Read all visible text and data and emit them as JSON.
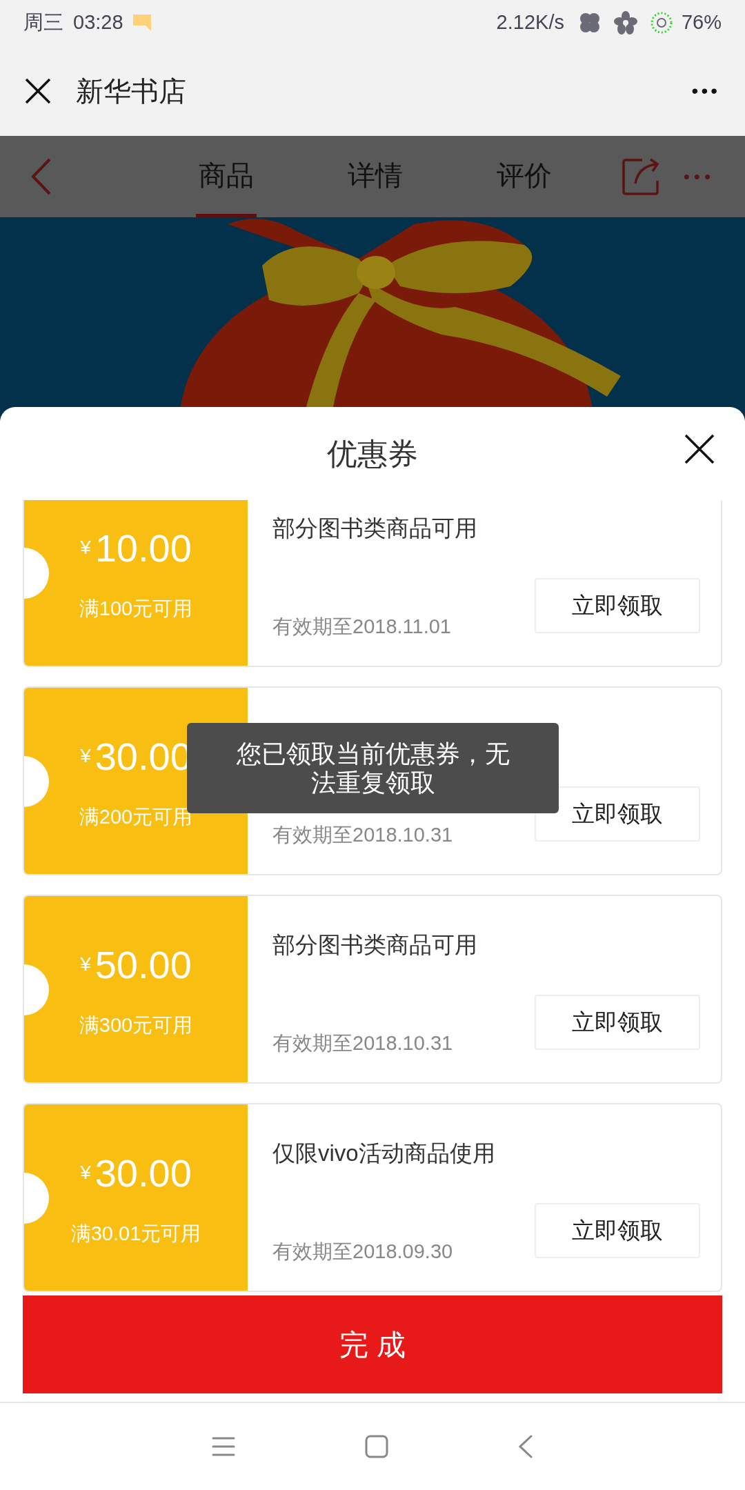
{
  "status_bar": {
    "day": "周三",
    "time": "03:28",
    "speed": "2.12K/s",
    "battery": "76%"
  },
  "title_bar": {
    "title": "新华书店",
    "more": "•••"
  },
  "product_header": {
    "tabs": [
      {
        "label": "商品",
        "selected": true
      },
      {
        "label": "详情",
        "selected": false
      },
      {
        "label": "评价",
        "selected": false
      }
    ],
    "more": "•••"
  },
  "coupon_sheet": {
    "title": "优惠券",
    "coupons": [
      {
        "currency": "¥",
        "amount": "10.00",
        "condition": "满100元可用",
        "scope": "部分图书类商品可用",
        "expiry": "有效期至2018.11.01",
        "action": "立即领取"
      },
      {
        "currency": "¥",
        "amount": "30.00",
        "condition": "满200元可用",
        "expiry": "有效期至2018.10.31",
        "action": "立即领取"
      },
      {
        "currency": "¥",
        "amount": "50.00",
        "condition": "满300元可用",
        "scope": "部分图书类商品可用",
        "expiry": "有效期至2018.10.31",
        "action": "立即领取"
      },
      {
        "currency": "¥",
        "amount": "30.00",
        "condition": "满30.01元可用",
        "scope": "仅限vivo活动商品使用",
        "expiry": "有效期至2018.09.30",
        "action": "立即领取"
      }
    ],
    "done_button": "完 成"
  },
  "toast": "您已领取当前优惠券，无法重复领取"
}
